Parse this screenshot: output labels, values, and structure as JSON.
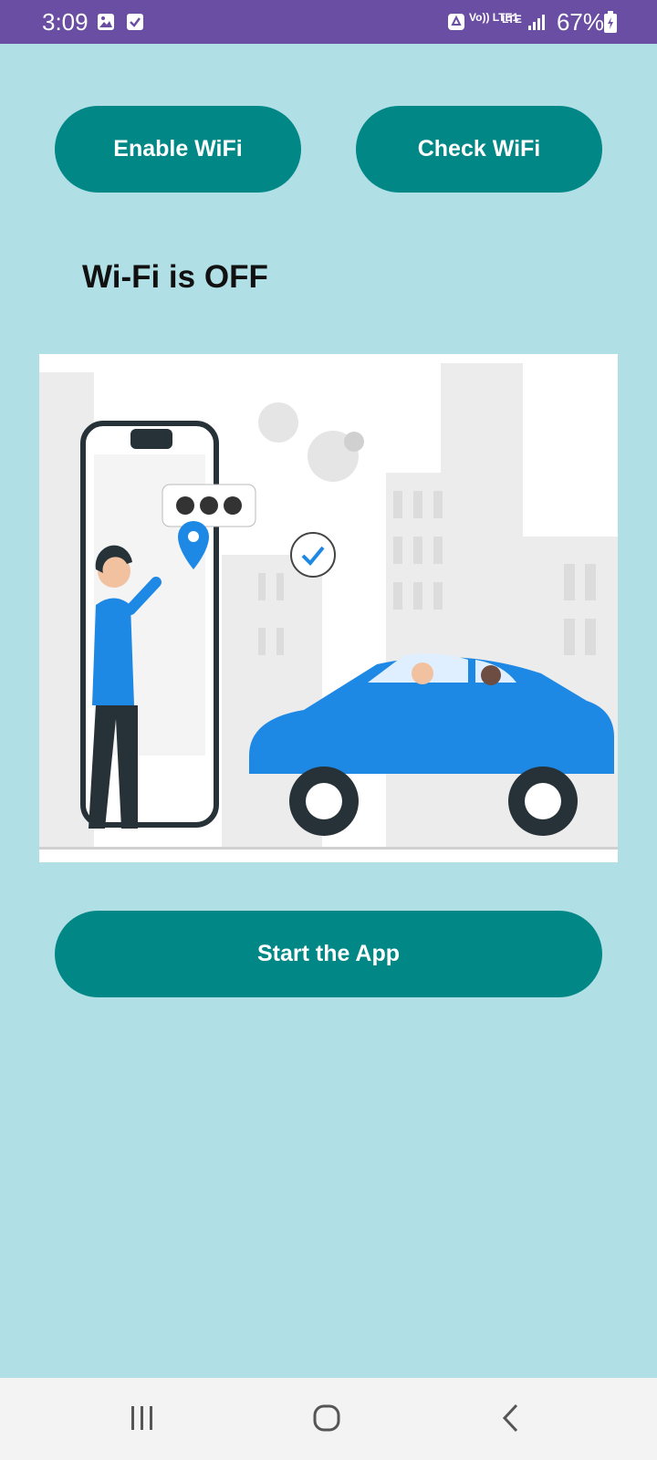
{
  "statusbar": {
    "time": "3:09",
    "network": "Vo)) LTE1",
    "signal": "LTE",
    "battery": "67%",
    "icons": [
      "gallery-icon",
      "checkbox-icon",
      "recycle-icon",
      "signal-icon",
      "battery-charging-icon"
    ]
  },
  "buttons": {
    "enable_wifi": "Enable WiFi",
    "check_wifi": "Check WiFi",
    "start_app": "Start the App"
  },
  "status": {
    "wifi_text": "Wi-Fi is OFF"
  },
  "illustration": {
    "alt": "illustration-taxi-app"
  },
  "navbar": {
    "icons": [
      "recent-apps-icon",
      "home-icon",
      "back-icon"
    ]
  },
  "colors": {
    "background": "#b0dfe5",
    "statusbar": "#6a4ea3",
    "button": "#008786",
    "button_text": "#ffffff",
    "car": "#1e88e5"
  }
}
